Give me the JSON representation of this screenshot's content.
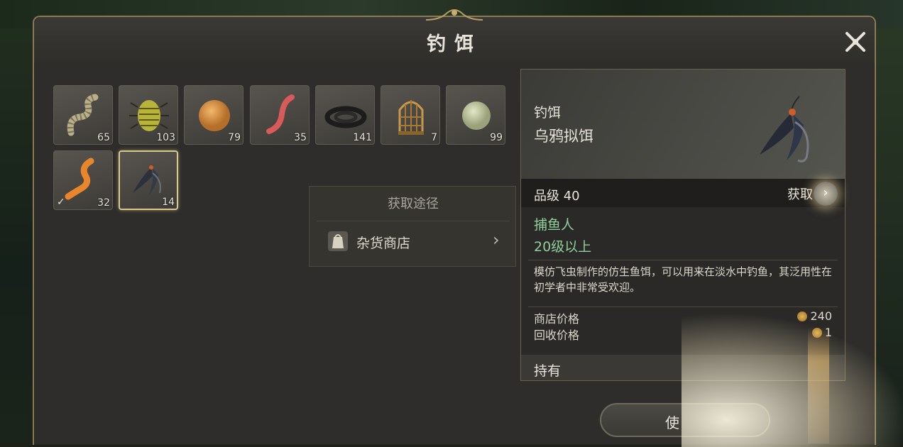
{
  "window": {
    "title": "钓饵"
  },
  "inventory": [
    {
      "name": "worm-grey",
      "count": "65"
    },
    {
      "name": "beetle",
      "count": "103"
    },
    {
      "name": "dough-ball",
      "count": "79"
    },
    {
      "name": "red-worm",
      "count": "35"
    },
    {
      "name": "black-eel",
      "count": "141"
    },
    {
      "name": "cage",
      "count": "7"
    },
    {
      "name": "green-ball",
      "count": "99"
    },
    {
      "name": "orange-worm",
      "count": "32",
      "equipped": true
    },
    {
      "name": "crow-lure",
      "count": "14",
      "selected": true
    }
  ],
  "acquisition": {
    "title": "获取途径",
    "source": "杂货商店"
  },
  "detail": {
    "category": "钓饵",
    "name": "乌鸦拟饵",
    "grade": "品级 40",
    "get_label": "获取",
    "req_job": "捕鱼人",
    "req_level": "20级以上",
    "description": "模仿飞虫制作的仿生鱼饵，可以用来在淡水中钓鱼，其泛用性在初学者中非常受欢迎。",
    "shop_price_label": "商店价格",
    "shop_price": "240",
    "sell_price_label": "回收价格",
    "sell_price": "1",
    "held_label": "持有"
  },
  "use_button": {
    "label": "使"
  }
}
